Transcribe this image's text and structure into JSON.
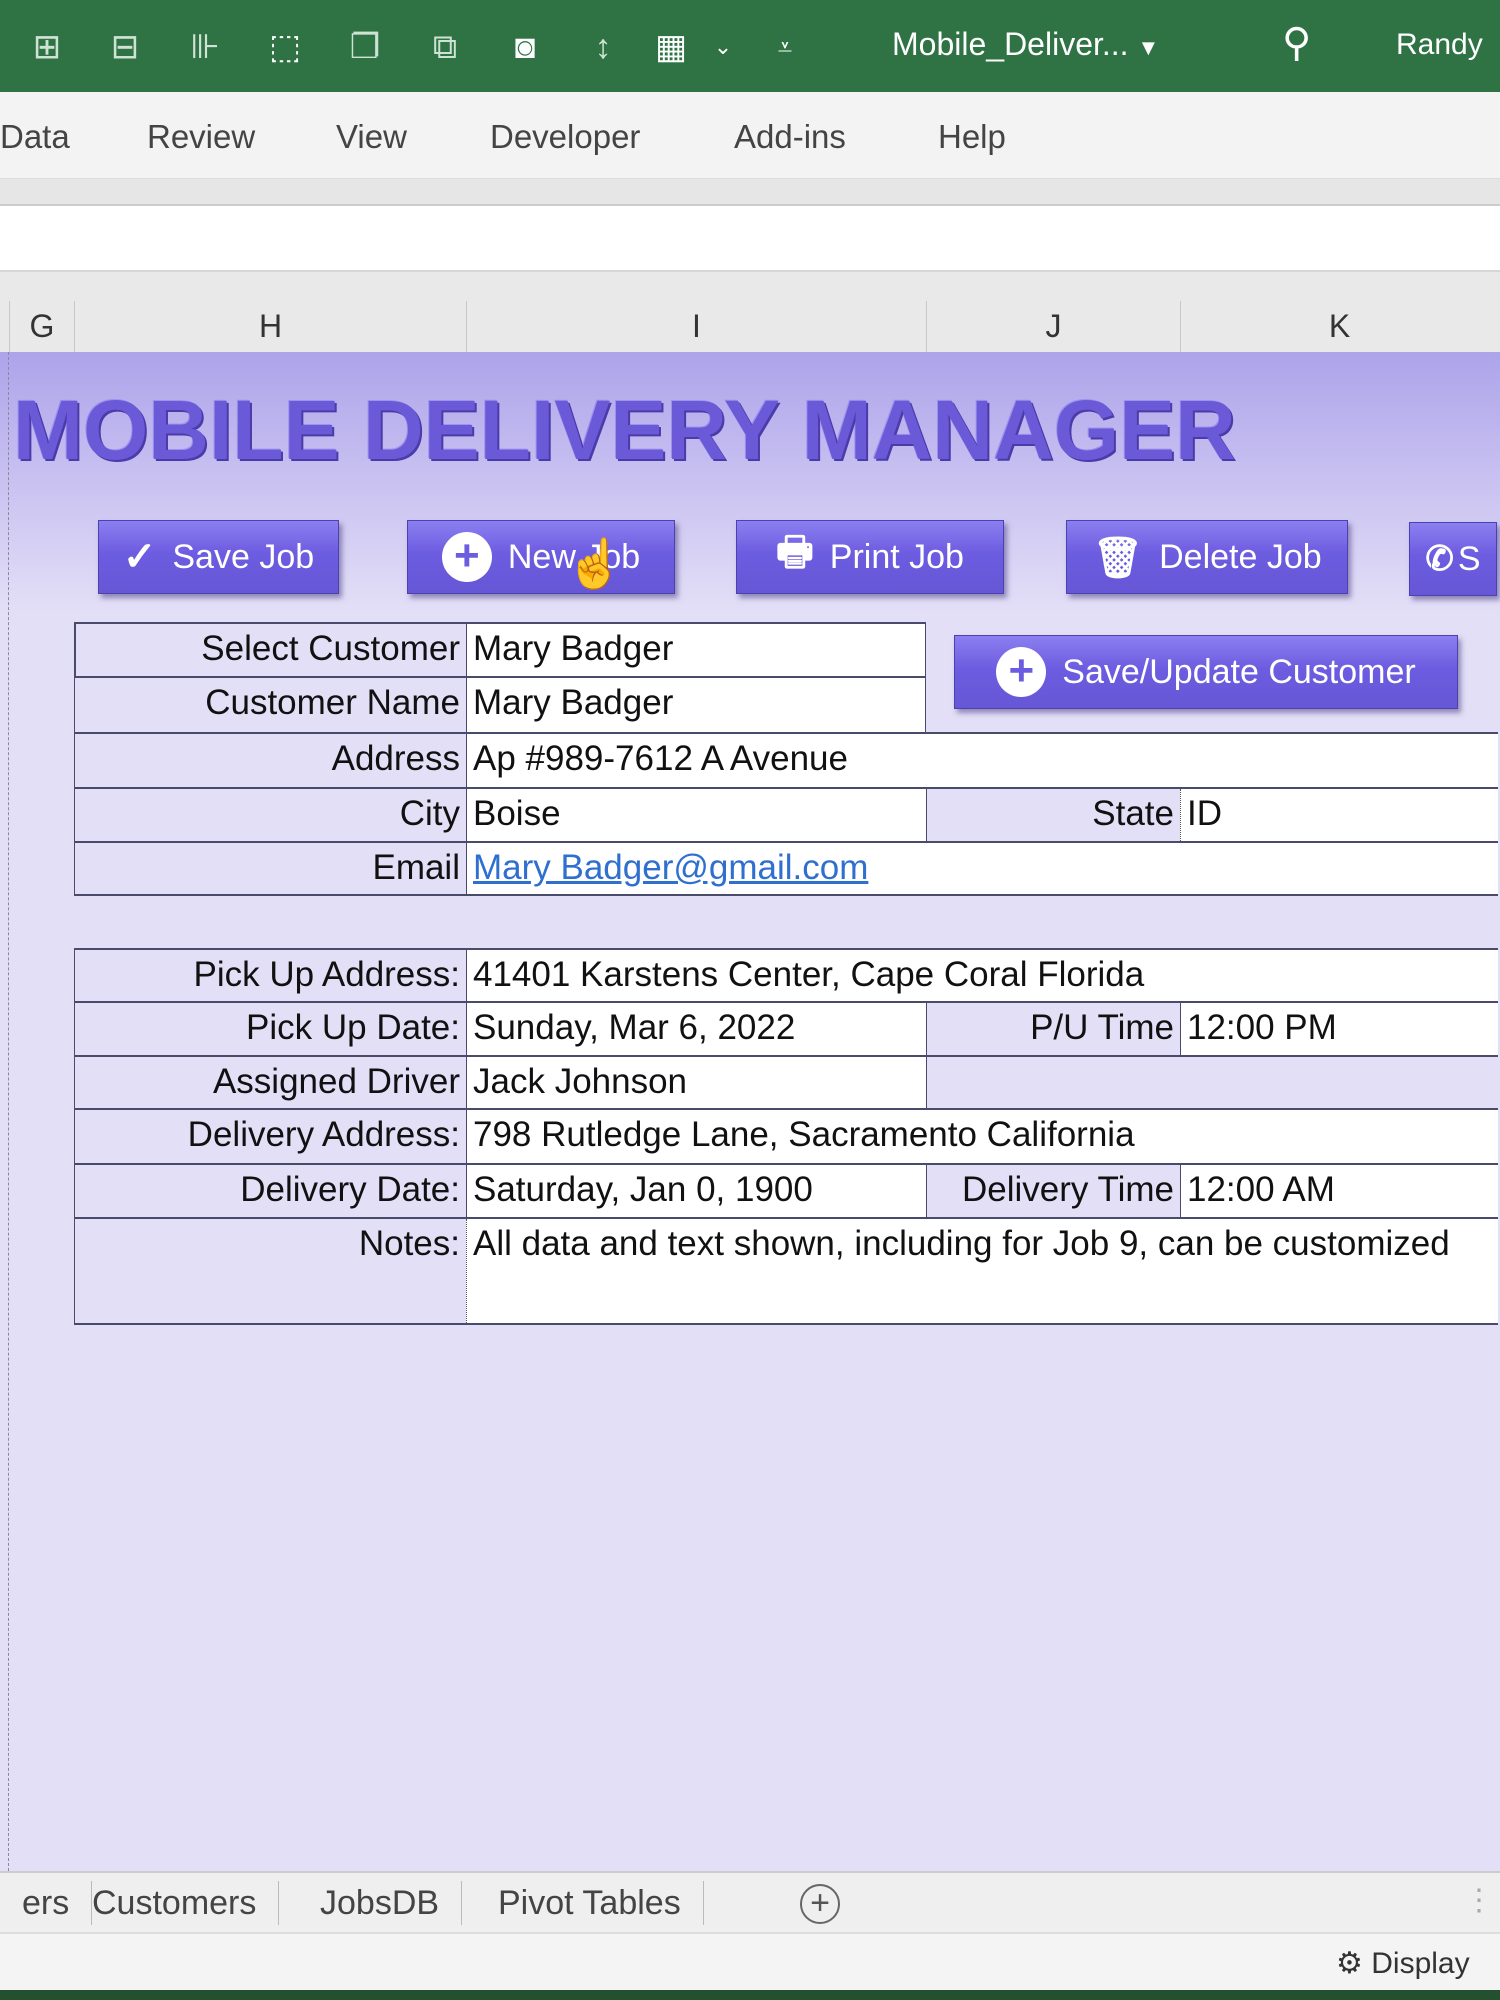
{
  "window": {
    "doc_title": "Mobile_Deliver...",
    "user": "Randy",
    "accent": "#2f7345",
    "search_icon": "search-icon"
  },
  "ribbon": {
    "tabs": [
      "Data",
      "Review",
      "View",
      "Developer",
      "Add-ins",
      "Help"
    ]
  },
  "columns": [
    "G",
    "H",
    "I",
    "J",
    "K"
  ],
  "sheet": {
    "title": "MOBILE DELIVERY MANAGER",
    "buttons": {
      "save_job": "Save Job",
      "new_job": "New Job",
      "print_job": "Print Job",
      "delete_job": "Delete Job",
      "fifth": "S",
      "save_customer": "Save/Update Customer"
    },
    "customer": {
      "select_customer_label": "Select Customer",
      "select_customer": "Mary Badger",
      "name_label": "Customer Name",
      "name": "Mary Badger",
      "address_label": "Address",
      "address": "Ap #989-7612 A Avenue",
      "city_label": "City",
      "city": "Boise",
      "state_label": "State",
      "state": "ID",
      "email_label": "Email",
      "email": "Mary Badger@gmail.com"
    },
    "job": {
      "pickup_address_label": "Pick Up Address:",
      "pickup_address": "41401 Karstens Center, Cape Coral Florida",
      "pickup_date_label": "Pick Up Date:",
      "pickup_date": "Sunday, Mar 6, 2022",
      "pu_time_label": "P/U Time",
      "pu_time": "12:00 PM",
      "driver_label": "Assigned Driver",
      "driver": "Jack Johnson",
      "delivery_address_label": "Delivery Address:",
      "delivery_address": "798 Rutledge Lane, Sacramento California",
      "delivery_date_label": "Delivery Date:",
      "delivery_date": "Saturday, Jan 0, 1900",
      "delivery_time_label": "Delivery Time",
      "delivery_time": "12:00 AM",
      "notes_label": "Notes:",
      "notes": "All data and text shown, including for Job 9, can be customized"
    }
  },
  "sheet_tabs": [
    "ers",
    "Customers",
    "JobsDB",
    "Pivot Tables"
  ],
  "status": {
    "display": "Display"
  }
}
